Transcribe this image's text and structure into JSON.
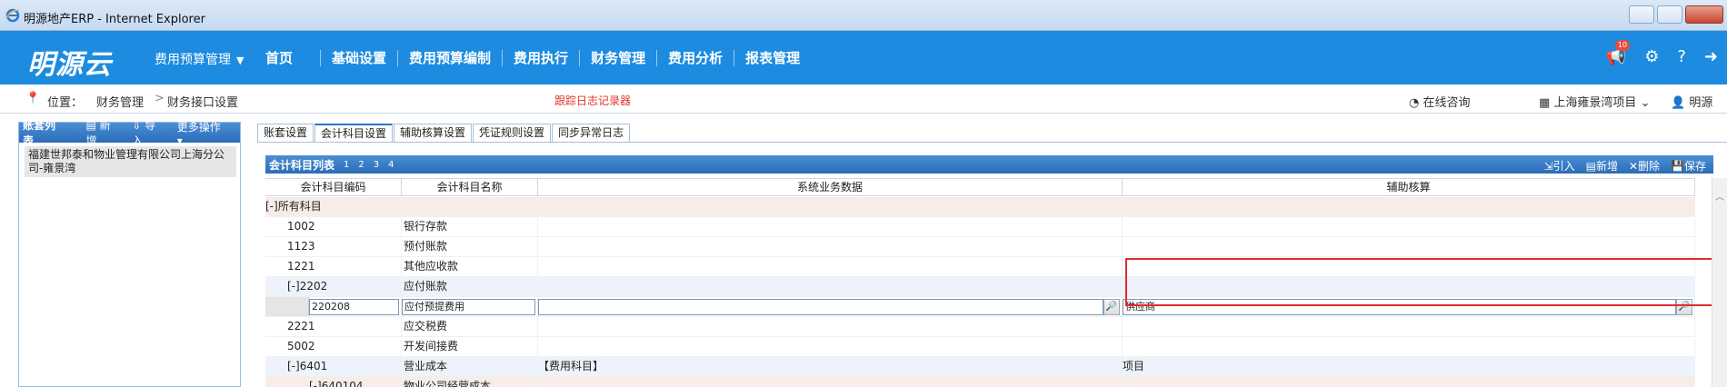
{
  "window": {
    "title": "明源地产ERP - Internet Explorer"
  },
  "header": {
    "logo": "明源云",
    "budget_menu": "费用预算管理",
    "nav": [
      "首页",
      "基础设置",
      "费用预算编制",
      "费用执行",
      "财务管理",
      "费用分析",
      "报表管理"
    ],
    "notification_count": "10"
  },
  "crumbbar": {
    "label": "位置：",
    "crumb1": "财务管理",
    "crumb_sep": ">",
    "crumb2": "财务接口设置",
    "trace_log": "跟踪日志记录器",
    "consult": "在线咨询",
    "project": "上海雍景湾项目",
    "user": "明源"
  },
  "leftpanel": {
    "title": "账套列表",
    "new": "新增",
    "import": "导入",
    "more": "更多操作",
    "org": "福建世邦泰和物业管理有限公司上海分公司-雍景湾"
  },
  "tabs": [
    "账套设置",
    "会计科目设置",
    "辅助核算设置",
    "凭证规则设置",
    "同步异常日志"
  ],
  "grid": {
    "title": "会计科目列表",
    "pages": [
      "1",
      "2",
      "3",
      "4"
    ],
    "tools": {
      "import": "引入",
      "new": "新增",
      "delete": "删除",
      "save": "保存"
    },
    "columns": [
      "会计科目编码",
      "会计科目名称",
      "系统业务数据",
      "辅助核算"
    ],
    "root": "[-]所有科目",
    "rows": [
      {
        "code": "1002",
        "name": "银行存款",
        "biz": "",
        "aux": ""
      },
      {
        "code": "1123",
        "name": "预付账款",
        "biz": "",
        "aux": ""
      },
      {
        "code": "1221",
        "name": "其他应收款",
        "biz": "",
        "aux": ""
      },
      {
        "code": "[-]2202",
        "name": "应付账款",
        "biz": "",
        "aux": ""
      }
    ],
    "edit_row": {
      "code": "220208",
      "name": "应付预提费用",
      "biz": "",
      "aux": "供应商"
    },
    "rows2": [
      {
        "code": "2221",
        "name": "应交税费",
        "biz": "",
        "aux": ""
      },
      {
        "code": "5002",
        "name": "开发间接费",
        "biz": "",
        "aux": ""
      },
      {
        "code": "[-]6401",
        "name": "营业成本",
        "biz": "【费用科目】",
        "aux": "项目"
      }
    ],
    "partial_row": {
      "code": "[-]640104",
      "name": "物业公司经营成本"
    }
  },
  "colors": {
    "header": "#1c8be0",
    "highlight": "#e02b2b"
  }
}
